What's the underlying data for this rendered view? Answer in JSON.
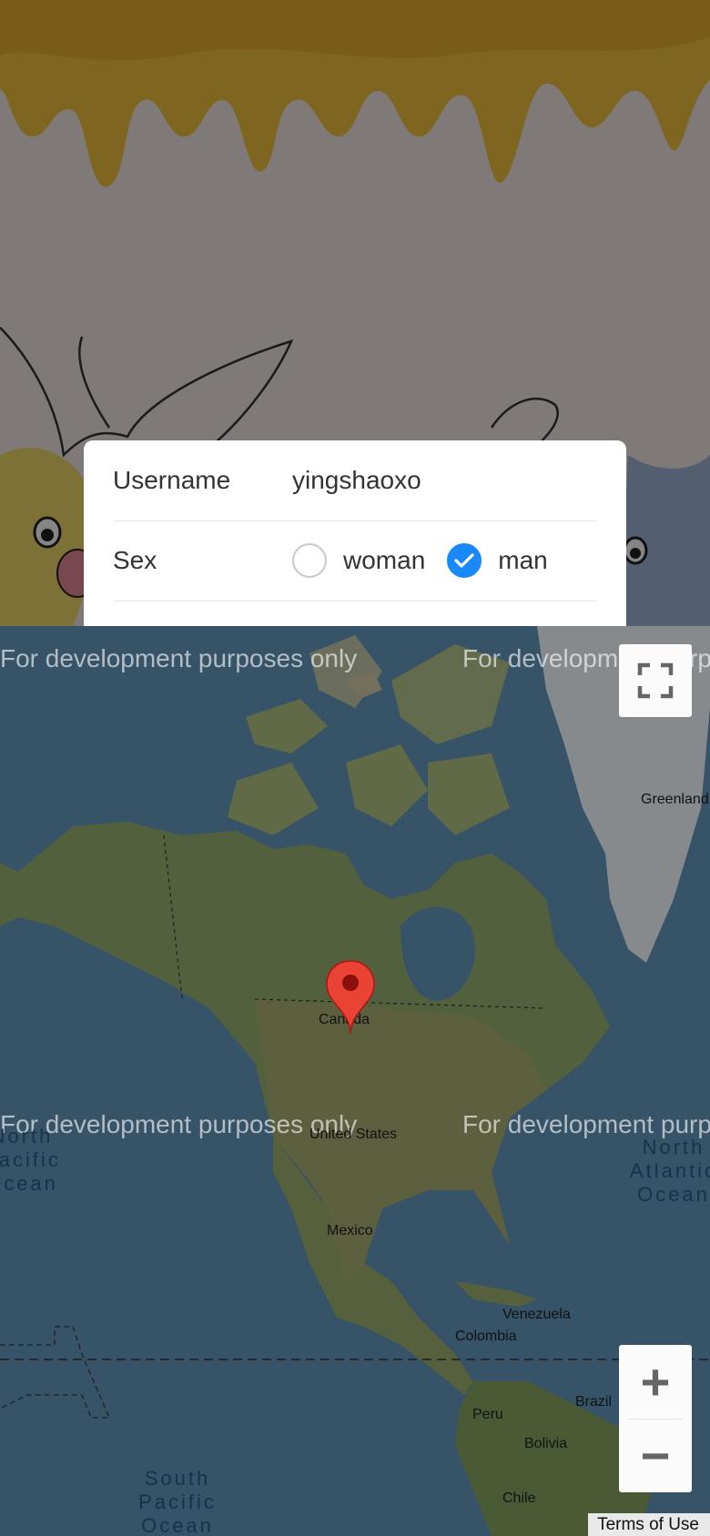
{
  "form": {
    "username_label": "Username",
    "username_value": "yingshaoxo",
    "sex_label": "Sex",
    "sex_options": [
      {
        "label": "woman",
        "checked": false
      },
      {
        "label": "man",
        "checked": true
      }
    ]
  },
  "map": {
    "watermark": "For development purposes only",
    "labels": {
      "greenland": "Greenland",
      "canada": "Canada",
      "united_states": "United States",
      "mexico": "Mexico",
      "venezuela": "Venezuela",
      "colombia": "Colombia",
      "brazil": "Brazil",
      "peru": "Peru",
      "bolivia": "Bolivia",
      "chile": "Chile",
      "north_pacific": "North Pacific Ocean",
      "north_atlantic": "North Atlantic Ocean",
      "south_pacific": "South Pacific Ocean"
    },
    "controls": {
      "fullscreen": "fullscreen-icon",
      "zoom_in": "+",
      "zoom_out": "−"
    },
    "terms": "Terms of Use"
  },
  "colors": {
    "accent": "#1989fa",
    "marker": "#ea4335",
    "honey": "#e5c24a"
  }
}
